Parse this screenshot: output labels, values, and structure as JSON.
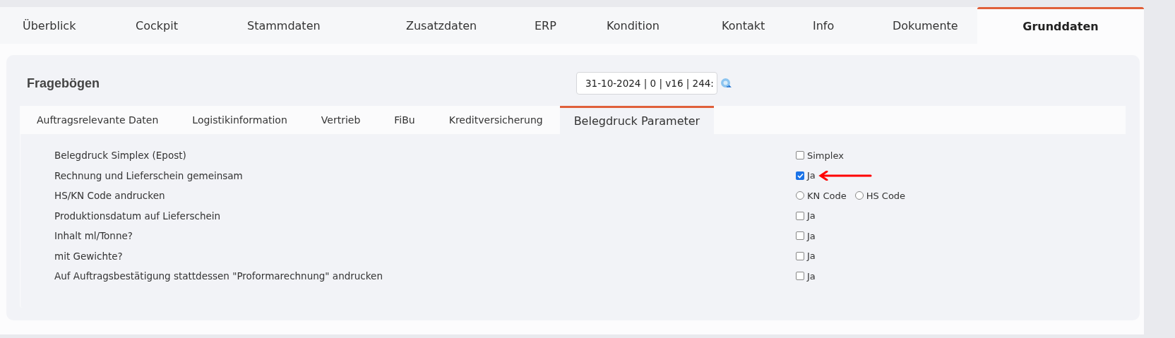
{
  "main_tabs": [
    {
      "label": "Überblick",
      "selected": false
    },
    {
      "label": "Cockpit",
      "selected": false
    },
    {
      "label": "Stammdaten",
      "selected": false
    },
    {
      "label": "Zusatzdaten",
      "selected": false
    },
    {
      "label": "ERP",
      "selected": false
    },
    {
      "label": "Kondition",
      "selected": false
    },
    {
      "label": "Kontakt",
      "selected": false
    },
    {
      "label": "Info",
      "selected": false
    },
    {
      "label": "Dokumente",
      "selected": false
    },
    {
      "label": "Grunddaten",
      "selected": true
    }
  ],
  "section": {
    "title": "Fragebögen",
    "version_select": {
      "value": "31-10-2024 | 0 | v16 | 244:"
    }
  },
  "sub_tabs": [
    {
      "label": "Auftragsrelevante Daten",
      "selected": false
    },
    {
      "label": "Logistikinformation",
      "selected": false
    },
    {
      "label": "Vertrieb",
      "selected": false
    },
    {
      "label": "FiBu",
      "selected": false
    },
    {
      "label": "Kreditversicherung",
      "selected": false
    },
    {
      "label": "Belegdruck Parameter",
      "selected": true
    }
  ],
  "rows": [
    {
      "kind": "checkbox",
      "label": "Belegdruck Simplex (Epost)",
      "option": "Simplex",
      "checked": false,
      "arrow": false
    },
    {
      "kind": "checkbox",
      "label": "Rechnung und Lieferschein gemeinsam",
      "option": "Ja",
      "checked": true,
      "arrow": true
    },
    {
      "kind": "radio",
      "label": "HS/KN Code andrucken",
      "options": [
        {
          "label": "KN Code",
          "selected": false
        },
        {
          "label": "HS Code",
          "selected": false
        }
      ]
    },
    {
      "kind": "checkbox",
      "label": "Produktionsdatum auf Lieferschein",
      "option": "Ja",
      "checked": false,
      "arrow": false
    },
    {
      "kind": "checkbox",
      "label": "Inhalt ml/Tonne?",
      "option": "Ja",
      "checked": false,
      "arrow": false
    },
    {
      "kind": "checkbox",
      "label": "mit Gewichte?",
      "option": "Ja",
      "checked": false,
      "arrow": false
    },
    {
      "kind": "checkbox",
      "label": "Auf Auftragsbestätigung stattdessen \"Proformarechnung\" andrucken",
      "option": "Ja",
      "checked": false,
      "arrow": false
    }
  ]
}
